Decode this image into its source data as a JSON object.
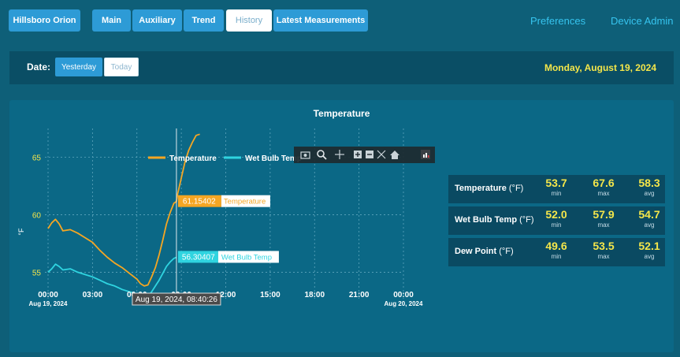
{
  "nav": {
    "brand": "Hillsboro Orion",
    "tabs": [
      {
        "label": "Main"
      },
      {
        "label": "Auxiliary"
      },
      {
        "label": "Trend"
      },
      {
        "label": "History"
      },
      {
        "label": "Latest Measurements"
      }
    ],
    "active_tab": "History",
    "links": {
      "preferences": "Preferences",
      "device_admin": "Device Admin"
    }
  },
  "date_bar": {
    "label": "Date:",
    "options": [
      "Yesterday",
      "Today"
    ],
    "selected": "Yesterday",
    "display_date": "Monday, August 19, 2024"
  },
  "chart": {
    "title": "Temperature",
    "y_label": "°F",
    "legend": [
      "Temperature",
      "Wet Bulb Temp"
    ],
    "toolbar_icons": [
      "camera-icon",
      "zoom-icon",
      "pan-icon",
      "zoom-in-icon",
      "zoom-out-icon",
      "autoscale-icon",
      "home-icon",
      "logo-icon"
    ],
    "hover": {
      "time_label": "Aug 19, 2024, 08:40:26",
      "temperature_label": "61.15402",
      "temperature_name": "Temperature",
      "wetbulb_label": "56.30407",
      "wetbulb_name": "Wet Bulb Temp"
    },
    "x_ticks": [
      {
        "label": "00:00",
        "sub": "Aug 19, 2024"
      },
      {
        "label": "03:00",
        "sub": ""
      },
      {
        "label": "06:00",
        "sub": ""
      },
      {
        "label": "09:00",
        "sub": ""
      },
      {
        "label": "12:00",
        "sub": ""
      },
      {
        "label": "15:00",
        "sub": ""
      },
      {
        "label": "18:00",
        "sub": ""
      },
      {
        "label": "21:00",
        "sub": ""
      },
      {
        "label": "00:00",
        "sub": "Aug 20, 2024"
      }
    ],
    "y_ticks": [
      "55",
      "60",
      "65"
    ],
    "colors": {
      "temperature": "#f5a623",
      "wetbulb": "#2fd4e0",
      "tick": "#f4e64a"
    }
  },
  "chart_data": {
    "type": "line",
    "title": "Temperature",
    "xlabel": "",
    "ylabel": "°F",
    "x_unit": "hours since 00:00 Aug 19, 2024",
    "xlim": [
      0,
      24
    ],
    "ylim": [
      52.7,
      67.5
    ],
    "series": [
      {
        "name": "Temperature",
        "x": [
          0,
          0.25,
          0.5,
          0.75,
          1,
          1.5,
          2,
          2.5,
          3,
          3.5,
          4,
          4.5,
          5,
          5.5,
          6,
          6.25,
          6.5,
          6.75,
          7,
          7.25,
          7.5,
          7.75,
          8,
          8.25,
          8.5,
          8.67,
          8.75,
          9,
          9.25,
          9.5,
          9.75,
          10,
          10.25
        ],
        "y": [
          58.8,
          59.3,
          59.6,
          59.2,
          58.6,
          58.7,
          58.4,
          58.0,
          57.6,
          56.9,
          56.3,
          55.8,
          55.4,
          54.9,
          54.4,
          54.0,
          53.8,
          53.9,
          54.6,
          55.4,
          56.5,
          57.8,
          59.2,
          60.2,
          61.0,
          61.15,
          61.8,
          63.2,
          64.6,
          65.6,
          66.3,
          66.9,
          67.0
        ]
      },
      {
        "name": "Wet Bulb Temp",
        "x": [
          0,
          0.25,
          0.5,
          0.75,
          1,
          1.5,
          2,
          2.5,
          3,
          3.5,
          4,
          4.5,
          5,
          5.5,
          6,
          6.25,
          6.5,
          6.75,
          7,
          7.25,
          7.5,
          7.75,
          8,
          8.25,
          8.5,
          8.67
        ],
        "y": [
          55.0,
          55.3,
          55.7,
          55.5,
          55.2,
          55.3,
          55.0,
          54.8,
          54.6,
          54.3,
          54.0,
          53.8,
          53.5,
          53.3,
          53.1,
          52.9,
          52.8,
          52.9,
          53.3,
          53.8,
          54.3,
          54.9,
          55.5,
          55.9,
          56.2,
          56.3
        ]
      }
    ]
  },
  "stats": [
    {
      "label": "Temperature",
      "unit": "(°F)",
      "min": "53.7",
      "max": "67.6",
      "avg": "58.3"
    },
    {
      "label": "Wet Bulb Temp",
      "unit": "(°F)",
      "min": "52.0",
      "max": "57.9",
      "avg": "54.7"
    },
    {
      "label": "Dew Point",
      "unit": "(°F)",
      "min": "49.6",
      "max": "53.5",
      "avg": "52.1"
    }
  ],
  "stat_captions": {
    "min": "min",
    "max": "max",
    "avg": "avg"
  }
}
